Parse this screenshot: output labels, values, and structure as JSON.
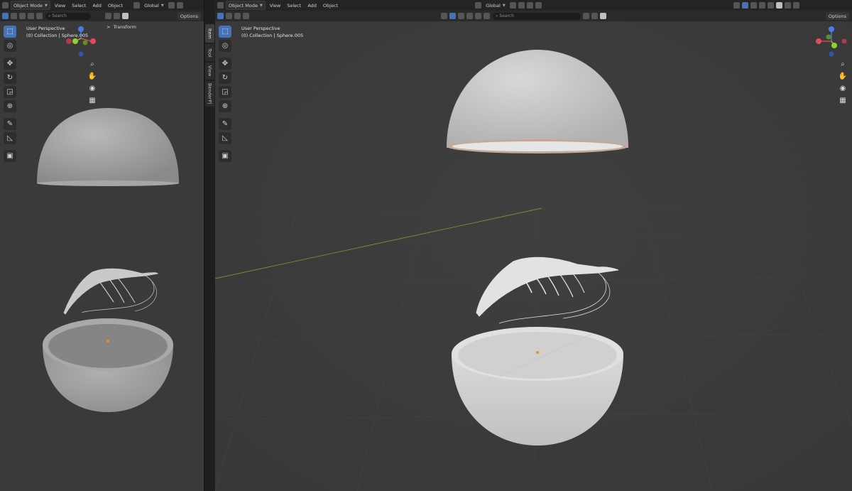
{
  "header": {
    "mode": "Object Mode",
    "menus": [
      "View",
      "Select",
      "Add",
      "Object"
    ],
    "transform_orientation": "Global",
    "search_placeholder": "Search",
    "options": "Options"
  },
  "left_viewport": {
    "perspective": "User Perspective",
    "collection": "(0) Collection | Sphere.005",
    "transform_panel": "Transform",
    "transform_arrow": ">"
  },
  "right_viewport": {
    "perspective": "User Perspective",
    "collection": "(0) Collection | Sphere.005"
  },
  "side_tabs": [
    "Item",
    "Tool",
    "View",
    "BenderP|"
  ],
  "gizmo": {
    "x": "X",
    "y": "Y",
    "z": "Z"
  },
  "colors": {
    "viewport_bg": "#3a3a3a",
    "active_tool": "#4772b3",
    "axis_x": "#e54a5a",
    "axis_y": "#8bd134",
    "axis_z": "#4a7de8",
    "model": "#d2d2d2"
  },
  "tools": [
    "select-box",
    "cursor",
    "move",
    "rotate",
    "scale",
    "transform",
    "annotate",
    "measure",
    "add-cube"
  ],
  "nav_icons": [
    "zoom-icon",
    "hand-pan-icon",
    "camera-icon",
    "grid-icon"
  ]
}
